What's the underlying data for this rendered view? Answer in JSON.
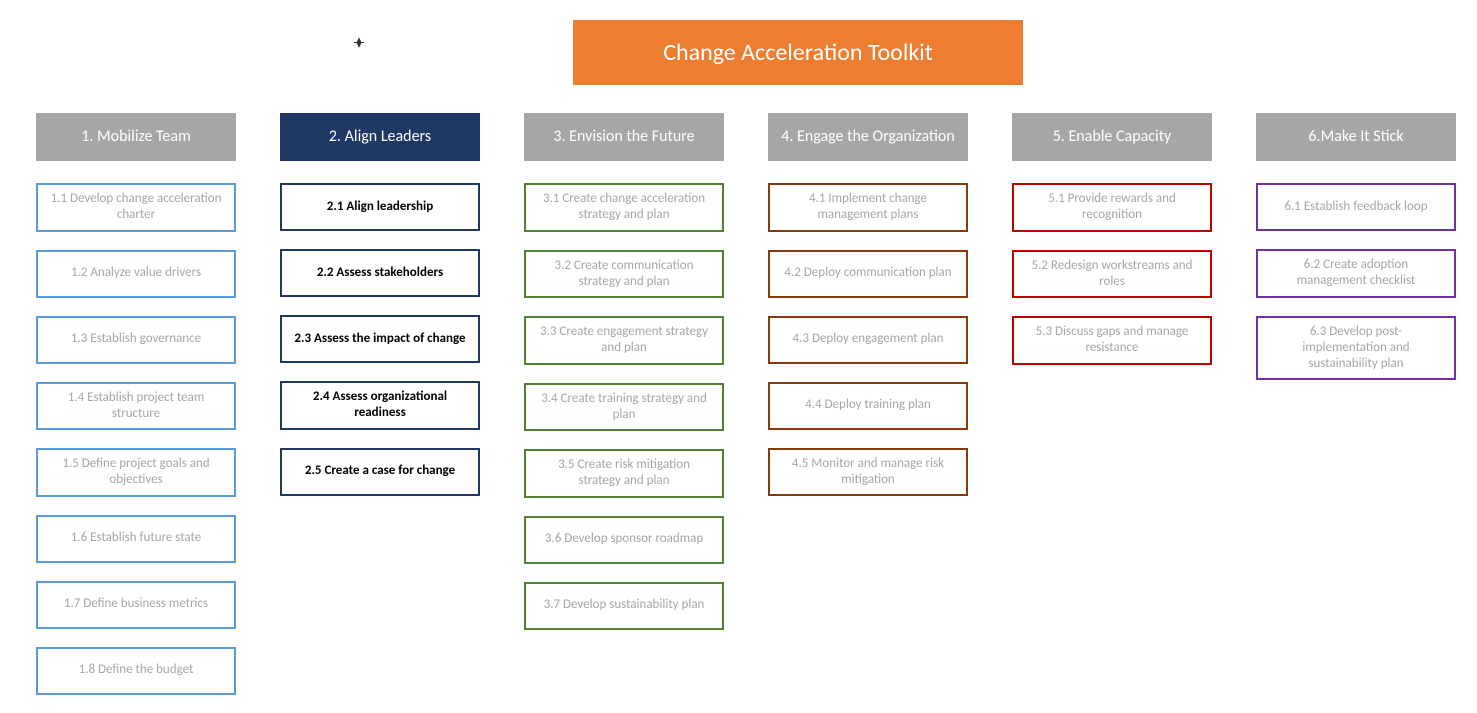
{
  "title": "Change Acceleration Toolkit",
  "columns": [
    {
      "header": "1. Mobilize Team",
      "headerStyle": "gray",
      "borderClass": "border-blue",
      "active": false,
      "items": [
        "1.1 Develop change acceleration charter",
        "1.2 Analyze value drivers",
        "1.3 Establish governance",
        "1.4 Establish project team structure",
        "1.5 Define project goals and objectives",
        "1.6 Establish future state",
        "1.7 Define business metrics",
        "1.8 Define the budget"
      ]
    },
    {
      "header": "2. Align Leaders",
      "headerStyle": "navy",
      "borderClass": "border-navy",
      "active": true,
      "items": [
        "2.1 Align leadership",
        "2.2 Assess stakeholders",
        "2.3 Assess the impact of change",
        "2.4 Assess organizational readiness",
        "2.5 Create a case for change"
      ]
    },
    {
      "header": "3. Envision the Future",
      "headerStyle": "gray",
      "borderClass": "border-green",
      "active": false,
      "items": [
        "3.1 Create change acceleration strategy and plan",
        "3.2 Create communication strategy and plan",
        "3.3 Create engagement strategy and plan",
        "3.4 Create training strategy and plan",
        "3.5 Create risk mitigation strategy and plan",
        "3.6 Develop sponsor roadmap",
        "3.7 Develop sustainability plan"
      ]
    },
    {
      "header": "4. Engage the Organization",
      "headerStyle": "gray",
      "borderClass": "border-brown",
      "active": false,
      "items": [
        "4.1 Implement change management plans",
        "4.2 Deploy communication plan",
        "4.3 Deploy engagement plan",
        "4.4 Deploy training plan",
        "4.5 Monitor and manage risk mitigation"
      ]
    },
    {
      "header": "5. Enable Capacity",
      "headerStyle": "gray",
      "borderClass": "border-red",
      "active": false,
      "items": [
        "5.1 Provide rewards and recognition",
        "5.2 Redesign workstreams and roles",
        "5.3 Discuss gaps and manage resistance"
      ]
    },
    {
      "header": "6.Make It Stick",
      "headerStyle": "gray",
      "borderClass": "border-purple",
      "active": false,
      "items": [
        "6.1 Establish feedback loop",
        "6.2 Create adoption management checklist",
        "6.3 Develop post-implementation and sustainability plan"
      ]
    }
  ]
}
